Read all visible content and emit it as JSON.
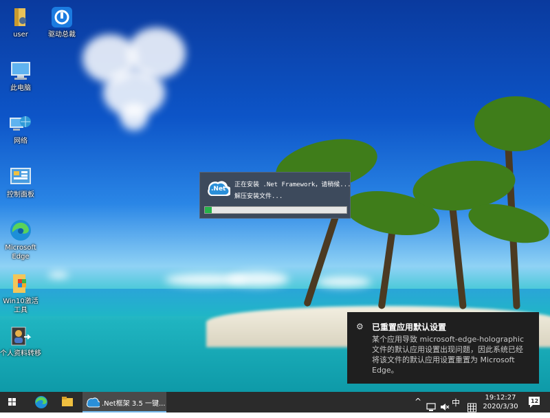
{
  "desktop_icons": [
    {
      "label": "user",
      "icon": "folder-icon"
    },
    {
      "label": "驱动总裁",
      "icon": "driver-icon"
    },
    {
      "label": "此电脑",
      "icon": "computer-icon"
    },
    {
      "label": "网络",
      "icon": "network-icon"
    },
    {
      "label": "控制面板",
      "icon": "control-panel-icon"
    },
    {
      "label": "Microsoft Edge",
      "icon": "edge-icon"
    },
    {
      "label": "Win10激活工具",
      "icon": "activation-icon"
    },
    {
      "label": "个人资料转移",
      "icon": "profile-transfer-icon"
    }
  ],
  "install_dialog": {
    "logo_text": ".Net",
    "line1": "正在安装 .Net Framework，请稍候...",
    "line2": "解压安装文件...",
    "progress_fraction": 0.05
  },
  "toast": {
    "title": "已重置应用默认设置",
    "body": "某个应用导致 microsoft-edge-holographic 文件的默认应用设置出现问题，因此系统已经将该文件的默认应用设置重置为 Microsoft Edge。"
  },
  "taskbar": {
    "app_label": ".Net框架 3.5 一键...",
    "ime": "中",
    "time": "19:12:27",
    "date": "2020/3/30",
    "notification_count": "12"
  },
  "colors": {
    "taskbar": "#2b2b2b",
    "toast": "#1f1f1f",
    "progress": "#26b34a",
    "accent": "#76b9ed"
  }
}
